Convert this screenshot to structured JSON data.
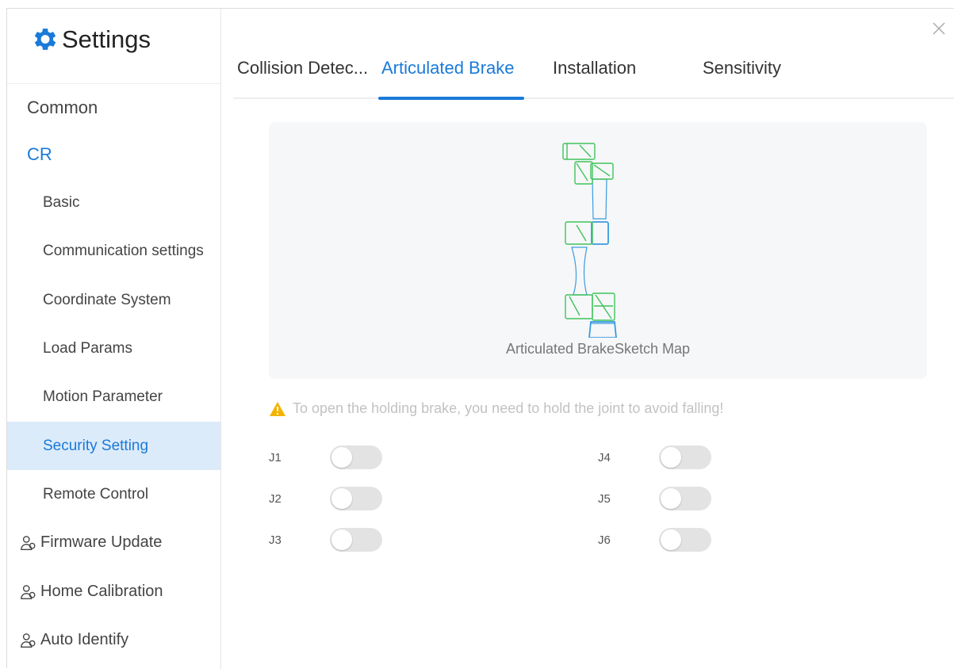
{
  "app": {
    "title": "Settings",
    "close_icon": "close-icon",
    "settings_icon": "gear-icon"
  },
  "sidebar": {
    "items": [
      {
        "label": "Common"
      },
      {
        "label": "CR"
      },
      {
        "label": "Basic"
      },
      {
        "label": "Communication settings"
      },
      {
        "label": "Coordinate System"
      },
      {
        "label": "Load Params"
      },
      {
        "label": "Motion Parameter"
      },
      {
        "label": "Security Setting"
      },
      {
        "label": "Remote Control"
      },
      {
        "label": "Firmware Update",
        "icon": "user-group-icon"
      },
      {
        "label": "Home Calibration",
        "icon": "user-group-icon"
      },
      {
        "label": "Auto Identify",
        "icon": "user-group-icon"
      }
    ],
    "active_item": "Security Setting"
  },
  "tabs": [
    {
      "label": "Collision Detec..."
    },
    {
      "label": "Articulated Brake"
    },
    {
      "label": "Installation"
    },
    {
      "label": "Sensitivity"
    }
  ],
  "active_tab": "Articulated Brake",
  "sketch": {
    "caption": "Articulated BrakeSketch Map"
  },
  "warning": {
    "icon": "warning-icon",
    "text": "To open the holding brake, you need to hold the joint to avoid falling!"
  },
  "joints": [
    {
      "label": "J1",
      "enabled": false
    },
    {
      "label": "J2",
      "enabled": false
    },
    {
      "label": "J3",
      "enabled": false
    },
    {
      "label": "J4",
      "enabled": false
    },
    {
      "label": "J5",
      "enabled": false
    },
    {
      "label": "J6",
      "enabled": false
    }
  ],
  "colors": {
    "accent": "#1a7ad9",
    "active_bg": "#dcebfa",
    "robot_green": "#3fc35a",
    "robot_blue": "#3a9be0",
    "warning": "#f2b400"
  }
}
